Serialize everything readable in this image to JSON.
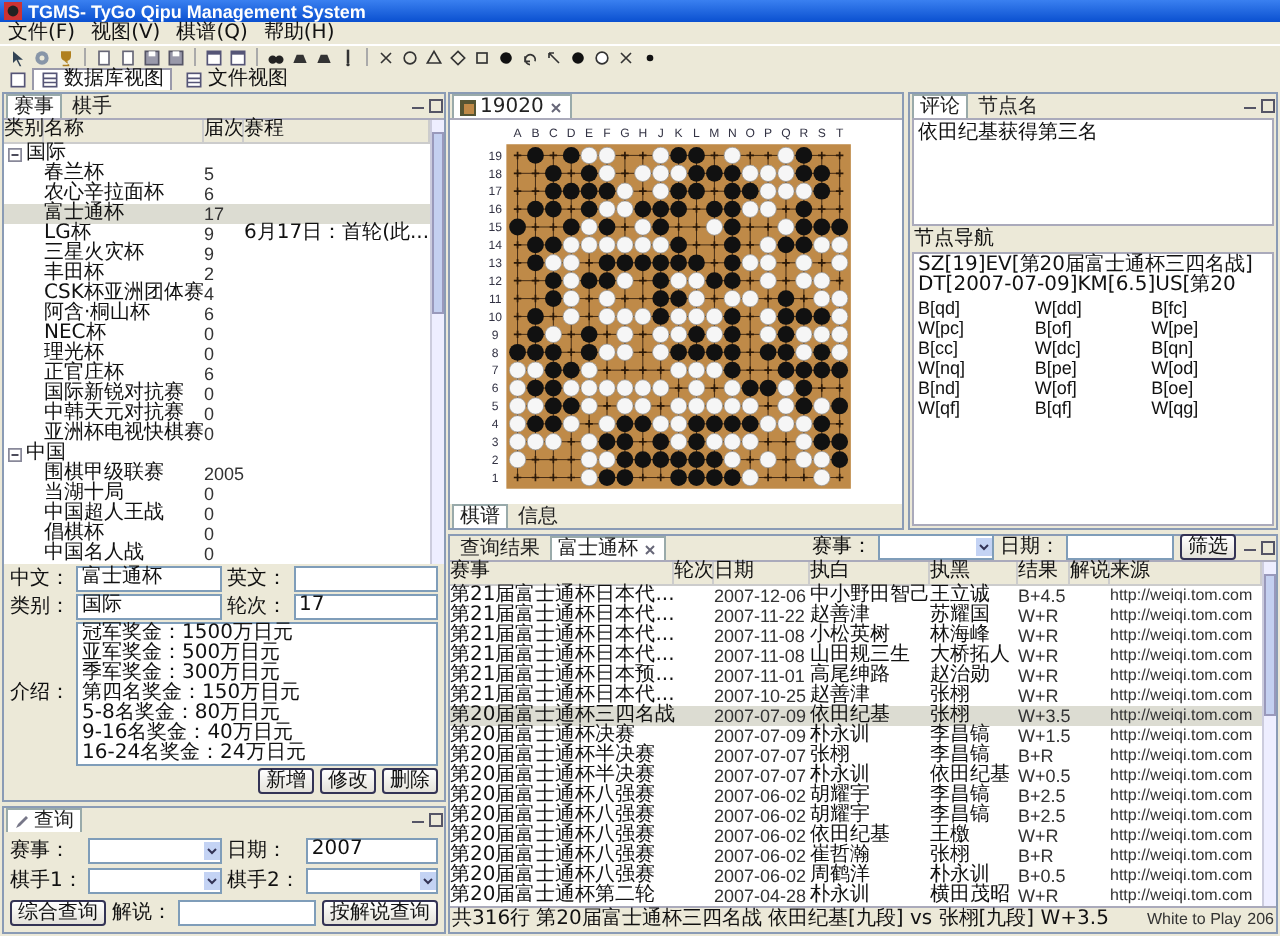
{
  "window": {
    "title": "TGMS- TyGo Qipu Management System"
  },
  "menu": [
    "文件(F)",
    "视图(V)",
    "棋谱(Q)",
    "帮助(H)"
  ],
  "perspectives": [
    {
      "label": "数据库视图",
      "selected": true
    },
    {
      "label": "文件视图",
      "selected": false
    }
  ],
  "left_tabs": [
    {
      "label": "赛事",
      "selected": true
    },
    {
      "label": "棋手",
      "selected": false
    }
  ],
  "tree": {
    "columns": [
      "类别",
      "名称",
      "届次",
      "赛程"
    ],
    "groups": [
      {
        "label": "国际",
        "expanded": true,
        "children": [
          {
            "name": "春兰杯",
            "count": "5",
            "selected": false
          },
          {
            "name": "农心辛拉面杯",
            "count": "6",
            "selected": false
          },
          {
            "name": "富士通杯",
            "count": "17",
            "selected": true
          },
          {
            "name": "LG杯",
            "count": "9",
            "schedule": "6月17日：首轮(此...",
            "selected": false
          },
          {
            "name": "三星火灾杯",
            "count": "9",
            "selected": false
          },
          {
            "name": "丰田杯",
            "count": "2",
            "selected": false
          },
          {
            "name": "CSK杯亚洲团体赛",
            "count": "4",
            "selected": false
          },
          {
            "name": "阿含·桐山杯",
            "count": "6",
            "selected": false
          },
          {
            "name": "NEC杯",
            "count": "0",
            "selected": false
          },
          {
            "name": "理光杯",
            "count": "0",
            "selected": false
          },
          {
            "name": "正官庄杯",
            "count": "6",
            "selected": false
          },
          {
            "name": "国际新锐对抗赛",
            "count": "0",
            "selected": false
          },
          {
            "name": "中韩天元对抗赛",
            "count": "0",
            "selected": false
          },
          {
            "name": "亚洲杯电视快棋赛",
            "count": "0",
            "selected": false
          }
        ]
      },
      {
        "label": "中国",
        "expanded": true,
        "children": [
          {
            "name": "围棋甲级联赛",
            "count": "2005",
            "selected": false
          },
          {
            "name": "当湖十局",
            "count": "0",
            "selected": false
          },
          {
            "name": "中国超人王战",
            "count": "0",
            "selected": false
          },
          {
            "name": "倡棋杯",
            "count": "0",
            "selected": false
          },
          {
            "name": "中国名人战",
            "count": "0",
            "selected": false
          }
        ]
      }
    ]
  },
  "detail": {
    "fields": [
      {
        "label": "中文：",
        "value": "富士通杯"
      },
      {
        "label": "英文："
      },
      {
        "label": "类别：",
        "value": "国际"
      },
      {
        "label": "轮次：",
        "value": "17"
      }
    ],
    "intro_label": "介绍：",
    "intro_lines": [
      "冠军奖金：1500万日元",
      "亚军奖金：500万日元",
      "季军奖金：300万日元",
      "第四名奖金：150万日元",
      "5-8名奖金：80万日元",
      "9-16名奖金：40万日元",
      "16-24名奖金：24万日元"
    ],
    "buttons": [
      "新增",
      "修改",
      "删除"
    ]
  },
  "query": {
    "tab": "查询",
    "fields": [
      {
        "label": "赛事：",
        "kind": "combo"
      },
      {
        "label": "日期：",
        "kind": "text",
        "value": "2007"
      },
      {
        "label": "棋手1：",
        "kind": "combo"
      },
      {
        "label": "棋手2：",
        "kind": "combo"
      }
    ],
    "search_button": "综合查询",
    "comment_label": "解说：",
    "comment_button": "按解说查询"
  },
  "board_panel": {
    "tab": "19020",
    "columns": [
      "A",
      "B",
      "C",
      "D",
      "E",
      "F",
      "G",
      "H",
      "J",
      "K",
      "L",
      "M",
      "N",
      "O",
      "P",
      "Q",
      "R",
      "S",
      "T"
    ],
    "row_labels": [
      "19",
      "18",
      "17",
      "16",
      "15",
      "14",
      "13",
      "12",
      "11",
      "10",
      "9",
      "8",
      "7",
      "6",
      "5",
      "4",
      "3",
      "2",
      "1"
    ],
    "rows": [
      {
        "black": [
          false,
          true,
          false,
          true,
          false,
          false,
          false,
          false,
          false,
          true,
          true,
          false,
          false,
          false,
          false,
          false,
          true,
          false,
          false
        ],
        "white": [
          false,
          false,
          false,
          false,
          true,
          true,
          false,
          false,
          true,
          false,
          false,
          false,
          true,
          false,
          false,
          true,
          false,
          false,
          false
        ]
      },
      {
        "black": [
          false,
          false,
          true,
          false,
          true,
          false,
          false,
          false,
          false,
          false,
          true,
          true,
          true,
          false,
          false,
          false,
          true,
          true,
          false
        ],
        "white": [
          false,
          false,
          false,
          false,
          false,
          true,
          false,
          true,
          true,
          true,
          false,
          false,
          false,
          true,
          true,
          true,
          false,
          false,
          false
        ]
      },
      {
        "black": [
          false,
          false,
          true,
          true,
          true,
          true,
          false,
          false,
          false,
          true,
          true,
          false,
          true,
          true,
          false,
          false,
          false,
          true,
          false
        ],
        "white": [
          false,
          false,
          false,
          false,
          false,
          false,
          true,
          false,
          true,
          false,
          false,
          false,
          false,
          false,
          true,
          true,
          true,
          false,
          false
        ]
      },
      {
        "black": [
          false,
          true,
          true,
          false,
          true,
          false,
          false,
          true,
          true,
          true,
          false,
          true,
          true,
          false,
          false,
          false,
          true,
          false,
          false
        ],
        "white": [
          false,
          false,
          false,
          false,
          false,
          true,
          true,
          false,
          false,
          false,
          false,
          false,
          false,
          true,
          true,
          false,
          false,
          false,
          false
        ]
      },
      {
        "black": [
          true,
          false,
          false,
          true,
          false,
          true,
          false,
          false,
          true,
          false,
          false,
          false,
          true,
          false,
          false,
          false,
          true,
          true,
          true
        ],
        "white": [
          false,
          false,
          false,
          false,
          true,
          false,
          false,
          true,
          false,
          false,
          false,
          true,
          false,
          false,
          false,
          true,
          false,
          false,
          false
        ]
      },
      {
        "black": [
          false,
          true,
          true,
          false,
          false,
          false,
          false,
          false,
          false,
          true,
          false,
          false,
          true,
          false,
          false,
          true,
          true,
          false,
          false
        ],
        "white": [
          false,
          false,
          false,
          true,
          true,
          true,
          true,
          true,
          true,
          false,
          false,
          false,
          false,
          false,
          true,
          false,
          false,
          true,
          true
        ]
      },
      {
        "black": [
          false,
          true,
          false,
          false,
          false,
          true,
          true,
          true,
          true,
          true,
          true,
          false,
          true,
          false,
          false,
          false,
          false,
          false,
          false
        ],
        "white": [
          false,
          false,
          true,
          true,
          false,
          false,
          false,
          false,
          false,
          false,
          false,
          false,
          false,
          true,
          true,
          false,
          true,
          false,
          true
        ]
      },
      {
        "black": [
          false,
          false,
          true,
          false,
          true,
          true,
          false,
          false,
          true,
          false,
          false,
          true,
          true,
          false,
          false,
          false,
          false,
          false,
          false
        ],
        "white": [
          false,
          false,
          false,
          true,
          false,
          false,
          true,
          false,
          false,
          true,
          true,
          false,
          false,
          false,
          true,
          false,
          true,
          true,
          false
        ]
      },
      {
        "black": [
          false,
          false,
          true,
          false,
          false,
          false,
          false,
          false,
          true,
          true,
          false,
          false,
          false,
          false,
          false,
          true,
          false,
          false,
          false
        ],
        "white": [
          false,
          false,
          false,
          true,
          false,
          true,
          false,
          false,
          false,
          false,
          true,
          false,
          true,
          true,
          false,
          false,
          false,
          true,
          true
        ]
      },
      {
        "black": [
          false,
          true,
          false,
          false,
          false,
          false,
          false,
          false,
          true,
          false,
          false,
          false,
          true,
          false,
          false,
          true,
          true,
          true,
          false
        ],
        "white": [
          false,
          false,
          false,
          true,
          false,
          true,
          true,
          true,
          false,
          true,
          true,
          true,
          false,
          false,
          true,
          false,
          false,
          false,
          true
        ]
      },
      {
        "black": [
          false,
          true,
          false,
          false,
          true,
          false,
          false,
          false,
          false,
          false,
          true,
          false,
          true,
          false,
          false,
          true,
          false,
          false,
          false
        ],
        "white": [
          false,
          false,
          true,
          false,
          false,
          false,
          true,
          false,
          true,
          true,
          false,
          true,
          false,
          false,
          true,
          false,
          true,
          true,
          true
        ]
      },
      {
        "black": [
          true,
          true,
          true,
          false,
          true,
          false,
          false,
          false,
          false,
          true,
          true,
          true,
          true,
          false,
          true,
          true,
          false,
          true,
          false
        ],
        "white": [
          false,
          false,
          false,
          false,
          false,
          true,
          true,
          false,
          true,
          false,
          false,
          false,
          false,
          false,
          false,
          false,
          true,
          false,
          true
        ]
      },
      {
        "black": [
          false,
          false,
          true,
          true,
          false,
          false,
          false,
          false,
          false,
          false,
          false,
          false,
          true,
          false,
          false,
          true,
          true,
          true,
          true
        ],
        "white": [
          true,
          true,
          false,
          false,
          true,
          false,
          false,
          false,
          false,
          true,
          true,
          true,
          false,
          false,
          false,
          false,
          false,
          false,
          false
        ]
      },
      {
        "black": [
          false,
          true,
          true,
          false,
          false,
          false,
          false,
          false,
          false,
          false,
          false,
          false,
          false,
          true,
          true,
          false,
          true,
          false,
          false
        ],
        "white": [
          true,
          false,
          false,
          true,
          true,
          true,
          true,
          true,
          true,
          false,
          true,
          false,
          true,
          false,
          false,
          true,
          false,
          false,
          false
        ]
      },
      {
        "black": [
          false,
          false,
          true,
          true,
          false,
          false,
          false,
          false,
          false,
          false,
          false,
          false,
          false,
          false,
          false,
          false,
          true,
          false,
          true
        ],
        "white": [
          true,
          true,
          false,
          false,
          true,
          false,
          true,
          true,
          false,
          true,
          true,
          true,
          true,
          true,
          false,
          true,
          false,
          true,
          false
        ]
      },
      {
        "black": [
          false,
          true,
          true,
          false,
          false,
          false,
          true,
          true,
          false,
          false,
          true,
          true,
          true,
          true,
          false,
          false,
          false,
          true,
          false
        ],
        "white": [
          true,
          false,
          false,
          true,
          false,
          true,
          false,
          false,
          true,
          true,
          false,
          false,
          false,
          false,
          true,
          true,
          true,
          false,
          false
        ]
      },
      {
        "black": [
          false,
          false,
          false,
          false,
          false,
          true,
          true,
          false,
          true,
          false,
          true,
          false,
          false,
          false,
          false,
          false,
          false,
          true,
          true
        ],
        "white": [
          true,
          true,
          true,
          false,
          true,
          false,
          false,
          false,
          false,
          true,
          false,
          true,
          true,
          true,
          false,
          false,
          true,
          false,
          false
        ]
      },
      {
        "black": [
          false,
          false,
          false,
          false,
          false,
          false,
          true,
          true,
          true,
          true,
          true,
          true,
          false,
          false,
          false,
          false,
          false,
          false,
          true
        ],
        "white": [
          true,
          false,
          false,
          false,
          true,
          true,
          false,
          false,
          false,
          false,
          false,
          false,
          true,
          false,
          true,
          false,
          true,
          true,
          false
        ]
      },
      {
        "black": [
          false,
          false,
          false,
          false,
          false,
          true,
          true,
          false,
          false,
          true,
          true,
          true,
          true,
          false,
          false,
          false,
          false,
          false,
          false
        ],
        "white": [
          false,
          false,
          false,
          false,
          true,
          false,
          false,
          false,
          false,
          false,
          false,
          false,
          false,
          true,
          false,
          false,
          false,
          true,
          false
        ]
      }
    ],
    "bottom_tabs": [
      {
        "label": "棋谱",
        "selected": true
      },
      {
        "label": "信息",
        "selected": false
      }
    ]
  },
  "comment_panel": {
    "tabs": [
      {
        "label": "评论",
        "selected": true
      },
      {
        "label": "节点名",
        "selected": false
      }
    ],
    "text": "依田纪基获得第三名",
    "nav_title": "节点导航",
    "nav_items": [
      "SZ[19]EV[第20届富士通杯三四名战]DT[2007-07-09]KM[6.5]US[第20",
      "B[qd]",
      "W[dd]",
      "B[fc]",
      "W[pc]",
      "B[of]",
      "W[pe]",
      "B[cc]",
      "W[dc]",
      "B[qn]",
      "W[nq]",
      "B[pe]",
      "W[od]",
      "B[nd]",
      "W[of]",
      "B[oe]",
      "W[qf]",
      "B[qf]",
      "W[qg]"
    ]
  },
  "results": {
    "tabs": [
      {
        "label": "查询结果",
        "selected": false,
        "closable": false
      },
      {
        "label": "富士通杯",
        "selected": true,
        "closable": true
      }
    ],
    "filter": {
      "event_label": "赛事：",
      "date_label": "日期：",
      "button": "筛选"
    },
    "columns": [
      "赛事",
      "轮次",
      "日期",
      "执白",
      "执黑",
      "结果",
      "解说",
      "来源"
    ],
    "rows": [
      {
        "event": "第21届富士通杯日本代...",
        "date": "2007-12-06",
        "white": "中小野田智己",
        "black": "王立诚",
        "result": "B+4.5",
        "source": "http://weiqi.tom.com",
        "selected": false
      },
      {
        "event": "第21届富士通杯日本代...",
        "date": "2007-11-22",
        "white": "赵善津",
        "black": "苏耀国",
        "result": "W+R",
        "source": "http://weiqi.tom.com",
        "selected": false
      },
      {
        "event": "第21届富士通杯日本代...",
        "date": "2007-11-08",
        "white": "小松英树",
        "black": "林海峰",
        "result": "W+R",
        "source": "http://weiqi.tom.com",
        "selected": false
      },
      {
        "event": "第21届富士通杯日本代...",
        "date": "2007-11-08",
        "white": "山田规三生",
        "black": "大桥拓人",
        "result": "W+R",
        "source": "http://weiqi.tom.com",
        "selected": false
      },
      {
        "event": "第21届富士通杯日本预...",
        "date": "2007-11-01",
        "white": "高尾绅路",
        "black": "赵治勋",
        "result": "W+R",
        "source": "http://weiqi.tom.com",
        "selected": false
      },
      {
        "event": "第21届富士通杯日本代...",
        "date": "2007-10-25",
        "white": "赵善津",
        "black": "张栩",
        "result": "W+R",
        "source": "http://weiqi.tom.com",
        "selected": false
      },
      {
        "event": "第20届富士通杯三四名战",
        "date": "2007-07-09",
        "white": "依田纪基",
        "black": "张栩",
        "result": "W+3.5",
        "source": "http://weiqi.tom.com",
        "selected": true
      },
      {
        "event": "第20届富士通杯决赛",
        "date": "2007-07-09",
        "white": "朴永训",
        "black": "李昌镐",
        "result": "W+1.5",
        "source": "http://weiqi.tom.com",
        "selected": false
      },
      {
        "event": "第20届富士通杯半决赛",
        "date": "2007-07-07",
        "white": "张栩",
        "black": "李昌镐",
        "result": "B+R",
        "source": "http://weiqi.tom.com",
        "selected": false
      },
      {
        "event": "第20届富士通杯半决赛",
        "date": "2007-07-07",
        "white": "朴永训",
        "black": "依田纪基",
        "result": "W+0.5",
        "source": "http://weiqi.tom.com",
        "selected": false
      },
      {
        "event": "第20届富士通杯八强赛",
        "date": "2007-06-02",
        "white": "胡耀宇",
        "black": "李昌镐",
        "result": "B+2.5",
        "source": "http://weiqi.tom.com",
        "selected": false
      },
      {
        "event": "第20届富士通杯八强赛",
        "date": "2007-06-02",
        "white": "胡耀宇",
        "black": "李昌镐",
        "result": "B+2.5",
        "source": "http://weiqi.tom.com",
        "selected": false
      },
      {
        "event": "第20届富士通杯八强赛",
        "date": "2007-06-02",
        "white": "依田纪基",
        "black": "王檄",
        "result": "W+R",
        "source": "http://weiqi.tom.com",
        "selected": false
      },
      {
        "event": "第20届富士通杯八强赛",
        "date": "2007-06-02",
        "white": "崔哲瀚",
        "black": "张栩",
        "result": "B+R",
        "source": "http://weiqi.tom.com",
        "selected": false
      },
      {
        "event": "第20届富士通杯八强赛",
        "date": "2007-06-02",
        "white": "周鹤洋",
        "black": "朴永训",
        "result": "B+0.5",
        "source": "http://weiqi.tom.com",
        "selected": false
      },
      {
        "event": "第20届富士通杯第二轮",
        "date": "2007-04-28",
        "white": "朴永训",
        "black": "横田茂昭",
        "result": "W+R",
        "source": "http://weiqi.tom.com",
        "selected": false
      }
    ]
  },
  "status_bar": {
    "count": "共316行",
    "game": "第20届富士通杯三四名战 依田纪基[九段] vs 张栩[九段] W+3.5",
    "turn": "White to Play",
    "moves": "206"
  }
}
